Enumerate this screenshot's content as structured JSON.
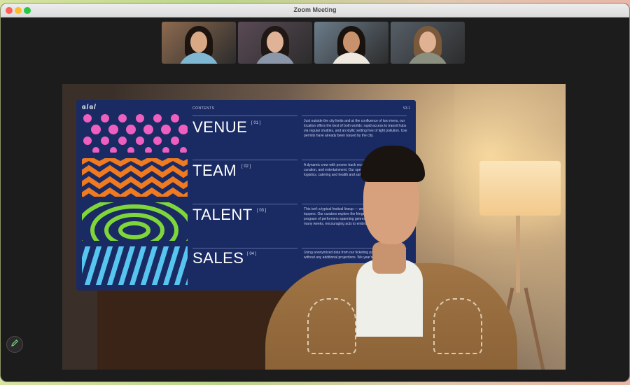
{
  "window": {
    "title": "Zoom Meeting"
  },
  "participants": [
    {
      "background": "#8d6a4f",
      "hair": "#1d1410",
      "skin": "#d9a986",
      "shirt": "#7fb6d2"
    },
    {
      "background": "#5a4a55",
      "hair": "#1f1814",
      "skin": "#e0b397",
      "shirt": "#8b97a8"
    },
    {
      "background": "#6b7c8a",
      "hair": "#1a120d",
      "skin": "#c8936c",
      "shirt": "#f0e9df"
    },
    {
      "background": "#555e67",
      "hair": "#7a5a3a",
      "skin": "#e0b193",
      "shirt": "#8a8f80"
    }
  ],
  "slide": {
    "logo": "ɞ/ɞ/",
    "heading": "CONTENTS",
    "version": "V3.1",
    "sections": [
      {
        "label": "VENUE",
        "number": "[ 01 ]",
        "description": "Just outside the city limits and at the confluence of two rivers, our location offers the best of both worlds: rapid access to transit hubs via regular shuttles, and an idyllic setting free of light pollution. Use permits have already been issued by the city."
      },
      {
        "label": "TEAM",
        "number": "[ 02 ]",
        "description": "A dynamic crew with proven track records in production, cultural curation, and entertainment. Our specialized partners to tackle logistics, catering and health and safety."
      },
      {
        "label": "TALENT",
        "number": "[ 03 ]",
        "description": "This isn't a typical festival lineup — we're bringing the kind of chart toppers. Our curators explore the fringes of our local scene, a program of performers spanning genres and disciplines. Across many weeks, encouraging acts to embrace one-off performances."
      },
      {
        "label": "SALES",
        "number": "[ 04 ]",
        "description": "Using anonymized data from our ticketing partner, we can sell without any additional projections. We year's ticket..."
      }
    ]
  }
}
